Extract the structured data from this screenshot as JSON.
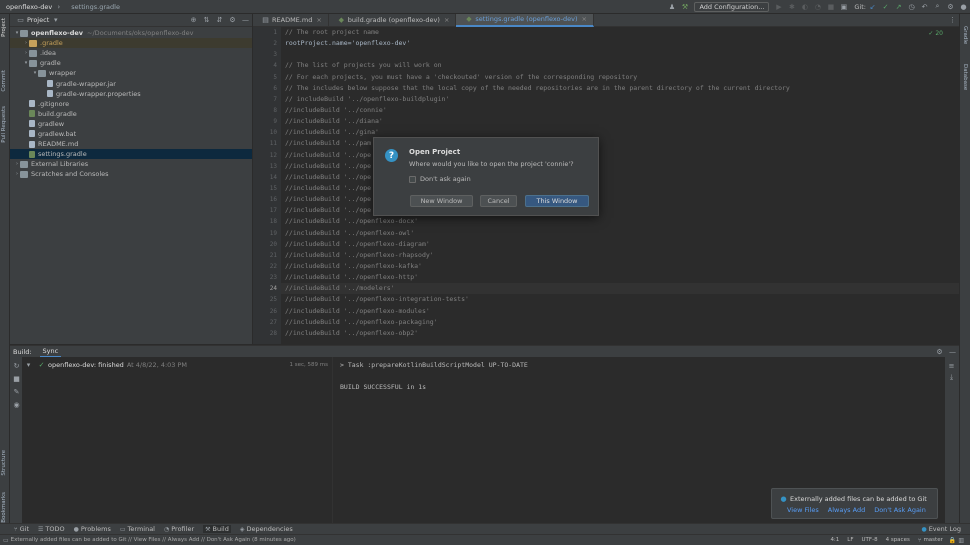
{
  "topbar": {
    "project": "openflexo-dev",
    "file": "settings.gradle",
    "add_config": "Add Configuration...",
    "git_label": "Git:"
  },
  "left_strip": {
    "tabs": [
      "Project",
      "Commit",
      "Pull Requests",
      "Structure",
      "Bookmarks"
    ]
  },
  "right_strip": {
    "tabs": [
      "Gradle",
      "Database"
    ]
  },
  "project_panel": {
    "title": "Project",
    "items": [
      {
        "label": "openflexo-dev",
        "extra": "~/Documents/oks/openflexo-dev",
        "indent": 0,
        "chev": "▾",
        "icon": "folder",
        "bold": true
      },
      {
        "label": ".gradle",
        "indent": 1,
        "chev": "›",
        "icon": "folder-y",
        "style": "hl"
      },
      {
        "label": ".idea",
        "indent": 1,
        "chev": "›",
        "icon": "folder"
      },
      {
        "label": "gradle",
        "indent": 1,
        "chev": "▾",
        "icon": "folder"
      },
      {
        "label": "wrapper",
        "indent": 2,
        "chev": "▾",
        "icon": "folder"
      },
      {
        "label": "gradle-wrapper.jar",
        "indent": 3,
        "chev": "",
        "icon": "file"
      },
      {
        "label": "gradle-wrapper.properties",
        "indent": 3,
        "chev": "",
        "icon": "file"
      },
      {
        "label": ".gitignore",
        "indent": 1,
        "chev": "",
        "icon": "file"
      },
      {
        "label": "build.gradle",
        "indent": 1,
        "chev": "",
        "icon": "file-g"
      },
      {
        "label": "gradlew",
        "indent": 1,
        "chev": "",
        "icon": "file"
      },
      {
        "label": "gradlew.bat",
        "indent": 1,
        "chev": "",
        "icon": "file"
      },
      {
        "label": "README.md",
        "indent": 1,
        "chev": "",
        "icon": "file"
      },
      {
        "label": "settings.gradle",
        "indent": 1,
        "chev": "",
        "icon": "file-g",
        "style": "sel"
      },
      {
        "label": "External Libraries",
        "indent": 0,
        "chev": "›",
        "icon": "folder"
      },
      {
        "label": "Scratches and Consoles",
        "indent": 0,
        "chev": "›",
        "icon": "folder"
      }
    ]
  },
  "tabs": [
    {
      "label": "README.md",
      "active": false
    },
    {
      "label": "build.gradle (openflexo-dev)",
      "active": false
    },
    {
      "label": "settings.gradle (openflexo-dev)",
      "active": true
    }
  ],
  "editor": {
    "inspection": "✓ 20",
    "line_numbers": [
      "1",
      "2",
      "3",
      "4",
      "5",
      "6",
      "7",
      "8",
      "9",
      "10",
      "11",
      "12",
      "13",
      "14",
      "15",
      "16",
      "17",
      "18",
      "19",
      "20",
      "21",
      "22",
      "23",
      "24",
      "25",
      "26",
      "27",
      "28"
    ],
    "lines": [
      "// The root project name",
      "rootProject.name='openflexo-dev'",
      "",
      "// The list of projects you will work on",
      "// For each projects, you must have a 'checkouted' version of the corresponding repository",
      "// The includes below suppose that the local copy of the needed repositories are in the parent directory of the current directory",
      "// includeBuild '../openflexo-buildplugin'",
      "//includeBuild '../connie'",
      "//includeBuild '../diana'",
      "//includeBuild '../gina'",
      "//includeBuild '../pam",
      "//includeBuild '../ope",
      "//includeBuild '../ope",
      "//includeBuild '../ope",
      "//includeBuild '../ope",
      "//includeBuild '../ope",
      "//includeBuild '../ope",
      "//includeBuild '../openflexo-docx'",
      "//includeBuild '../openflexo-owl'",
      "//includeBuild '../openflexo-diagram'",
      "//includeBuild '../openflexo-rhapsody'",
      "//includeBuild '../openflexo-kafka'",
      "//includeBuild '../openflexo-http'",
      "//includeBuild '../modelers'",
      "//includeBuild '../openflexo-integration-tests'",
      "//includeBuild '../openflexo-modules'",
      "//includeBuild '../openflexo-packaging'",
      "//includeBuild '../openflexo-obp2'"
    ]
  },
  "dialog": {
    "title": "Open Project",
    "message": "Where would you like to open the project 'connie'?",
    "checkbox": "Don't ask again",
    "btn_new": "New Window",
    "btn_cancel": "Cancel",
    "btn_this": "This Window"
  },
  "build": {
    "label": "Build:",
    "sync_tab": "Sync",
    "entry": "openflexo-dev: finished",
    "entry_time": "At 4/8/22, 4:03 PM",
    "duration": "1 sec, 589 ms",
    "output": [
      "> Task :prepareKotlinBuildScriptModel UP-TO-DATE",
      "",
      "BUILD SUCCESSFUL in 1s"
    ]
  },
  "notification": {
    "message": "Externally added files can be added to Git",
    "view": "View Files",
    "always": "Always Add",
    "dont": "Don't Ask Again"
  },
  "bottom_tabs": [
    "Git",
    "TODO",
    "Problems",
    "Terminal",
    "Profiler",
    "Build",
    "Dependencies"
  ],
  "event_log": "Event Log",
  "status": {
    "message": "Externally added files can be added to Git // View Files // Always Add // Don't Ask Again (8 minutes ago)",
    "pos": "4:1",
    "sep": "LF",
    "enc": "UTF-8",
    "indent": "4 spaces",
    "branch": "master"
  },
  "colors": {
    "accent": "#4a88c7",
    "primary_btn": "#365880",
    "success": "#59a869"
  }
}
